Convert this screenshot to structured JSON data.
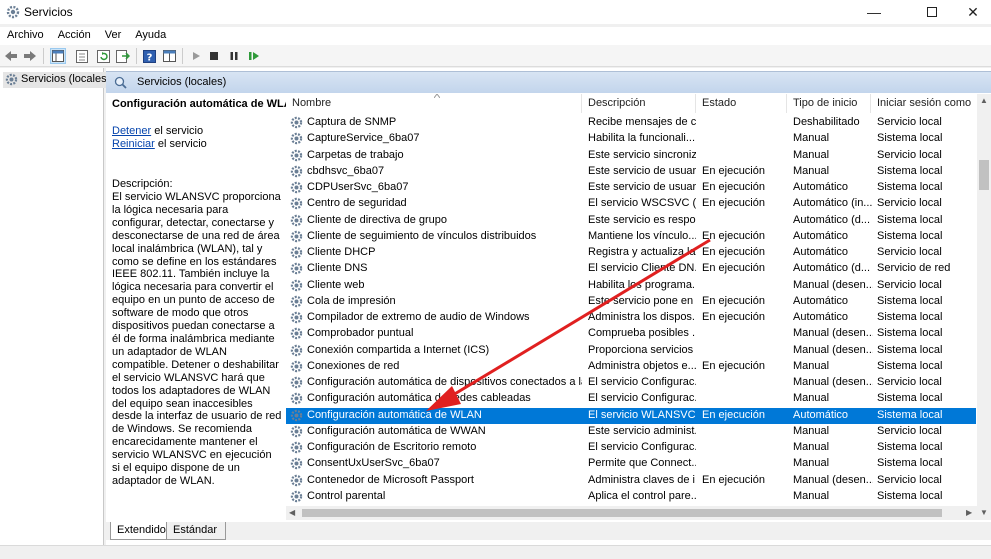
{
  "window": {
    "title": "Servicios"
  },
  "menu": [
    "Archivo",
    "Acción",
    "Ver",
    "Ayuda"
  ],
  "tree": {
    "root": "Servicios (locales)"
  },
  "panel": {
    "header": "Servicios (locales)"
  },
  "details": {
    "service_title": "Configuración automática de WLAN",
    "stop_link": "Detener",
    "stop_rest": " el servicio",
    "restart_link": "Reiniciar",
    "restart_rest": " el servicio",
    "desc_label": "Descripción:",
    "desc_text": "El servicio WLANSVC proporciona la lógica necesaria para configurar, detectar, conectarse y desconectarse de una red de área local inalámbrica (WLAN), tal y como se define en los estándares IEEE 802.11. También incluye la lógica necesaria para convertir el equipo en un punto de acceso de software de modo que otros dispositivos puedan conectarse a él de forma inalámbrica mediante un adaptador de WLAN compatible. Detener o deshabilitar el servicio WLANSVC hará que todos los adaptadores de WLAN del equipo sean inaccesibles desde la interfaz de usuario de red de Windows. Se recomienda encarecidamente mantener el servicio WLANSVC en ejecución si el equipo dispone de un adaptador de WLAN."
  },
  "columns": [
    "Nombre",
    "Descripción",
    "Estado",
    "Tipo de inicio",
    "Iniciar sesión como"
  ],
  "services": [
    {
      "name": "Captura de SNMP",
      "desc": "Recibe mensajes de c...",
      "state": "",
      "start": "Deshabilitado",
      "logon": "Servicio local"
    },
    {
      "name": "CaptureService_6ba07",
      "desc": "Habilita la funcionali...",
      "state": "",
      "start": "Manual",
      "logon": "Sistema local"
    },
    {
      "name": "Carpetas de trabajo",
      "desc": "Este servicio sincroniz...",
      "state": "",
      "start": "Manual",
      "logon": "Servicio local"
    },
    {
      "name": "cbdhsvc_6ba07",
      "desc": "Este servicio de usuar...",
      "state": "En ejecución",
      "start": "Manual",
      "logon": "Sistema local"
    },
    {
      "name": "CDPUserSvc_6ba07",
      "desc": "Este servicio de usuar...",
      "state": "En ejecución",
      "start": "Automático",
      "logon": "Sistema local"
    },
    {
      "name": "Centro de seguridad",
      "desc": "El servicio WSCSVC (C...",
      "state": "En ejecución",
      "start": "Automático (in...",
      "logon": "Servicio local"
    },
    {
      "name": "Cliente de directiva de grupo",
      "desc": "Este servicio es respo...",
      "state": "",
      "start": "Automático (d...",
      "logon": "Sistema local"
    },
    {
      "name": "Cliente de seguimiento de vínculos distribuidos",
      "desc": "Mantiene los vínculo...",
      "state": "En ejecución",
      "start": "Automático",
      "logon": "Sistema local"
    },
    {
      "name": "Cliente DHCP",
      "desc": "Registra y actualiza la...",
      "state": "En ejecución",
      "start": "Automático",
      "logon": "Servicio local"
    },
    {
      "name": "Cliente DNS",
      "desc": "El servicio Cliente DN...",
      "state": "En ejecución",
      "start": "Automático (d...",
      "logon": "Servicio de red"
    },
    {
      "name": "Cliente web",
      "desc": "Habilita los programa...",
      "state": "",
      "start": "Manual (desen...",
      "logon": "Servicio local"
    },
    {
      "name": "Cola de impresión",
      "desc": "Este servicio pone en ...",
      "state": "En ejecución",
      "start": "Automático",
      "logon": "Sistema local"
    },
    {
      "name": "Compilador de extremo de audio de Windows",
      "desc": "Administra los dispos...",
      "state": "En ejecución",
      "start": "Automático",
      "logon": "Sistema local"
    },
    {
      "name": "Comprobador puntual",
      "desc": "Comprueba posibles ...",
      "state": "",
      "start": "Manual (desen...",
      "logon": "Sistema local"
    },
    {
      "name": "Conexión compartida a Internet (ICS)",
      "desc": "Proporciona servicios ...",
      "state": "",
      "start": "Manual (desen...",
      "logon": "Sistema local"
    },
    {
      "name": "Conexiones de red",
      "desc": "Administra objetos e...",
      "state": "En ejecución",
      "start": "Manual",
      "logon": "Sistema local"
    },
    {
      "name": "Configuración automática de dispositivos conectados a la red",
      "desc": "El servicio Configurac...",
      "state": "",
      "start": "Manual (desen...",
      "logon": "Servicio local"
    },
    {
      "name": "Configuración automática de redes cableadas",
      "desc": "El servicio Configurac...",
      "state": "",
      "start": "Manual",
      "logon": "Sistema local"
    },
    {
      "name": "Configuración automática de WLAN",
      "desc": "El servicio WLANSVC ...",
      "state": "En ejecución",
      "start": "Automático",
      "logon": "Sistema local"
    },
    {
      "name": "Configuración automática de WWAN",
      "desc": "Este servicio administ...",
      "state": "",
      "start": "Manual",
      "logon": "Servicio local"
    },
    {
      "name": "Configuración de Escritorio remoto",
      "desc": "El servicio Configurac...",
      "state": "",
      "start": "Manual",
      "logon": "Sistema local"
    },
    {
      "name": "ConsentUxUserSvc_6ba07",
      "desc": "Permite que Connect...",
      "state": "",
      "start": "Manual",
      "logon": "Sistema local"
    },
    {
      "name": "Contenedor de Microsoft Passport",
      "desc": "Administra claves de i...",
      "state": "En ejecución",
      "start": "Manual (desen...",
      "logon": "Servicio local"
    },
    {
      "name": "Control parental",
      "desc": "Aplica el control pare...",
      "state": "",
      "start": "Manual",
      "logon": "Sistema local"
    }
  ],
  "selected_service": "Configuración automática de WLAN",
  "tabs": [
    "Extendido",
    "Estándar"
  ],
  "colors": {
    "selection": "#0078d7",
    "link": "#0645ad",
    "annotation_arrow": "#e02020"
  }
}
